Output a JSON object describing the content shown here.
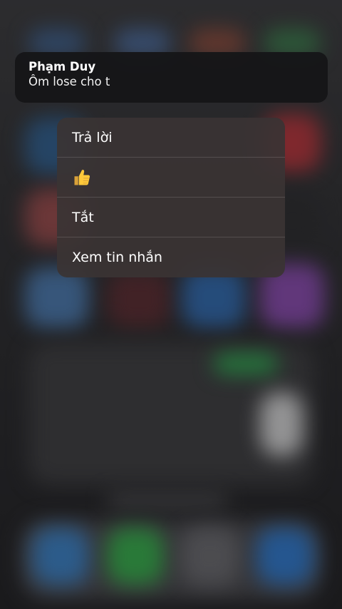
{
  "notification": {
    "sender": "Phạm Duy",
    "message": "Ôm lose cho t"
  },
  "menu": {
    "items": [
      {
        "label": "Trả lời"
      },
      {
        "icon": "thumbs-up-icon",
        "label": ""
      },
      {
        "label": "Tắt"
      },
      {
        "label": "Xem tin nhắn"
      }
    ]
  }
}
